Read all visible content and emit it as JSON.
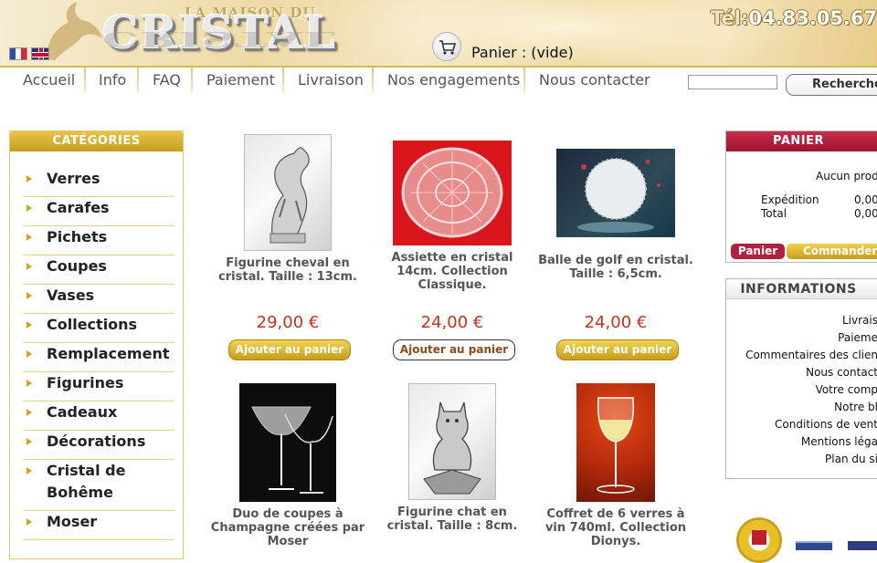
{
  "brand": {
    "name_top": "LA MAISON DU",
    "name_main": "CRISTAL",
    "logo_reflection": "CRISTAL"
  },
  "languages": [
    "fr",
    "en"
  ],
  "header": {
    "cart_label": "Panier : (vide)",
    "phone_label": "Tél:",
    "phone_number": "04.83.05.67."
  },
  "nav": {
    "items": [
      "Accueil",
      "Info",
      "FAQ",
      "Paiement",
      "Livraison",
      "Nos engagements",
      "Nous contacter"
    ],
    "search_placeholder": "",
    "search_button": "Recherche"
  },
  "categories": {
    "title": "CATÉGORIES",
    "items": [
      "Verres",
      "Carafes",
      "Pichets",
      "Coupes",
      "Vases",
      "Collections",
      "Remplacement",
      "Figurines",
      "Cadeaux",
      "Décorations",
      "Cristal de Bohême",
      "Moser"
    ]
  },
  "products": [
    {
      "name": "Figurine cheval en cristal. Taille : 13cm.",
      "price": "29,00 €",
      "button": "Ajouter au panier",
      "image": "crystal-horse"
    },
    {
      "name": "Assiette en cristal 14cm. Collection Classique.",
      "price": "24,00 €",
      "button": "Ajouter au panier",
      "image": "crystal-plate"
    },
    {
      "name": "Balle de golf en cristal. Taille : 6,5cm.",
      "price": "24,00 €",
      "button": "Ajouter au panier",
      "image": "crystal-golf-ball"
    },
    {
      "name": "Duo de coupes à Champagne créées par Moser",
      "image": "champagne-coupes"
    },
    {
      "name": "Figurine chat en cristal. Taille : 8cm.",
      "image": "crystal-cat"
    },
    {
      "name": "Coffret de 6 verres à vin 740ml. Collection Dionys.",
      "image": "wine-glass"
    }
  ],
  "cart_box": {
    "title": "PANIER",
    "empty_text": "Aucun prod",
    "shipping_label": "Expédition",
    "shipping_value": "0,00",
    "total_label": "Total",
    "total_value": "0,00",
    "btn_cart": "Panier",
    "btn_order": "Commander"
  },
  "info_box": {
    "title": "INFORMATIONS",
    "items": [
      "Livrais",
      "Paieme",
      "Commentaires des clien",
      "Nous contact",
      "Votre comp",
      "Notre bl",
      "Conditions de vent",
      "Mentions léga",
      "Plan du si"
    ]
  },
  "colors": {
    "gold": "#d0a520",
    "price_red": "#c2341e",
    "cart_red": "#b22040"
  }
}
